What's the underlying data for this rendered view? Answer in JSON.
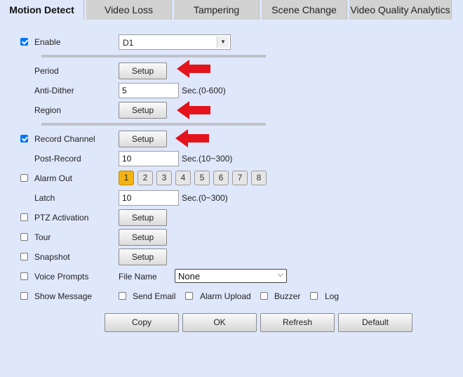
{
  "tabs": [
    {
      "label": "Motion Detect"
    },
    {
      "label": "Video Loss"
    },
    {
      "label": "Tampering"
    },
    {
      "label": "Scene Change"
    },
    {
      "label": "Video Quality Analytics"
    }
  ],
  "enable": {
    "label": "Enable",
    "checked": true,
    "channel": "D1"
  },
  "period": {
    "label": "Period",
    "button": "Setup"
  },
  "anti_dither": {
    "label": "Anti-Dither",
    "value": "5",
    "unit": "Sec.(0-600)"
  },
  "region": {
    "label": "Region",
    "button": "Setup"
  },
  "record_channel": {
    "label": "Record Channel",
    "checked": true,
    "button": "Setup"
  },
  "post_record": {
    "label": "Post-Record",
    "value": "10",
    "unit": "Sec.(10~300)"
  },
  "alarm_out": {
    "label": "Alarm Out",
    "checked": false,
    "channels": [
      "1",
      "2",
      "3",
      "4",
      "5",
      "6",
      "7",
      "8"
    ],
    "selected": "1"
  },
  "latch": {
    "label": "Latch",
    "value": "10",
    "unit": "Sec.(0~300)"
  },
  "ptz_activation": {
    "label": "PTZ Activation",
    "checked": false,
    "button": "Setup"
  },
  "tour": {
    "label": "Tour",
    "checked": false,
    "button": "Setup"
  },
  "snapshot": {
    "label": "Snapshot",
    "checked": false,
    "button": "Setup"
  },
  "voice_prompts": {
    "label": "Voice Prompts",
    "checked": false,
    "file_name_label": "File Name",
    "file_name_value": "None"
  },
  "show_message": {
    "label": "Show Message",
    "checked": false
  },
  "send_email": {
    "label": "Send Email",
    "checked": false
  },
  "alarm_upload": {
    "label": "Alarm Upload",
    "checked": false
  },
  "buzzer": {
    "label": "Buzzer",
    "checked": false
  },
  "log": {
    "label": "Log",
    "checked": false
  },
  "actions": {
    "copy": "Copy",
    "ok": "OK",
    "refresh": "Refresh",
    "default": "Default"
  },
  "colors": {
    "accent": "#0075ff",
    "selected_channel": "#f3b311",
    "annotation_arrow": "#e3141b",
    "background": "#dfe7fb"
  }
}
